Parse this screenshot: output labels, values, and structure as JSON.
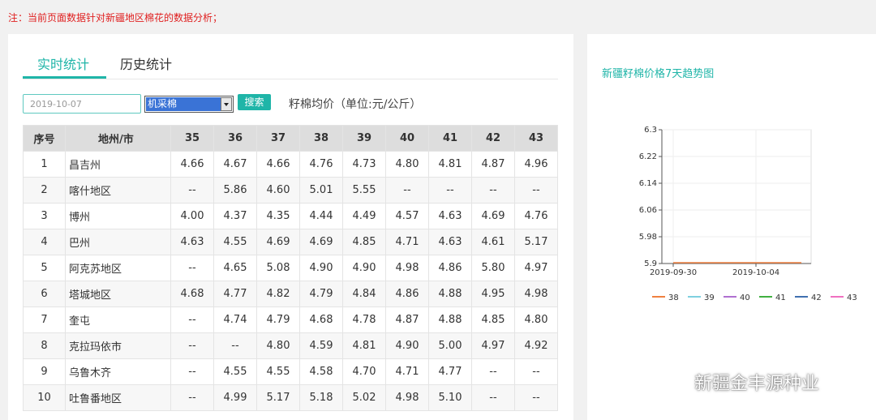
{
  "notice": "注：当前页面数据针对新疆地区棉花的数据分析；",
  "tabs": [
    {
      "label": "实时统计",
      "active": true
    },
    {
      "label": "历史统计",
      "active": false
    }
  ],
  "filters": {
    "date": "2019-10-07",
    "select_value": "机采棉",
    "search_label": "搜索",
    "unit_label": "籽棉均价（单位:元/公斤）"
  },
  "table": {
    "headers": [
      "序号",
      "地州/市",
      "35",
      "36",
      "37",
      "38",
      "39",
      "40",
      "41",
      "42",
      "43"
    ],
    "rows": [
      [
        "1",
        "昌吉州",
        "4.66",
        "4.67",
        "4.66",
        "4.76",
        "4.73",
        "4.80",
        "4.81",
        "4.87",
        "4.96"
      ],
      [
        "2",
        "喀什地区",
        "--",
        "5.86",
        "4.60",
        "5.01",
        "5.55",
        "--",
        "--",
        "--",
        "--"
      ],
      [
        "3",
        "博州",
        "4.00",
        "4.37",
        "4.35",
        "4.44",
        "4.49",
        "4.57",
        "4.63",
        "4.69",
        "4.76"
      ],
      [
        "4",
        "巴州",
        "4.63",
        "4.55",
        "4.69",
        "4.69",
        "4.85",
        "4.71",
        "4.63",
        "4.61",
        "5.17"
      ],
      [
        "5",
        "阿克苏地区",
        "--",
        "4.65",
        "5.08",
        "4.90",
        "4.90",
        "4.98",
        "4.86",
        "5.80",
        "4.97"
      ],
      [
        "6",
        "塔城地区",
        "4.68",
        "4.77",
        "4.82",
        "4.79",
        "4.84",
        "4.86",
        "4.88",
        "4.95",
        "4.98"
      ],
      [
        "7",
        "奎屯",
        "--",
        "4.74",
        "4.79",
        "4.68",
        "4.78",
        "4.87",
        "4.88",
        "4.85",
        "4.80"
      ],
      [
        "8",
        "克拉玛依市",
        "--",
        "--",
        "4.80",
        "4.59",
        "4.81",
        "4.90",
        "5.00",
        "4.97",
        "4.92"
      ],
      [
        "9",
        "乌鲁木齐",
        "--",
        "4.55",
        "4.55",
        "4.58",
        "4.70",
        "4.71",
        "4.77",
        "--",
        "--"
      ],
      [
        "10",
        "吐鲁番地区",
        "--",
        "4.99",
        "5.17",
        "5.18",
        "5.02",
        "4.98",
        "5.10",
        "--",
        "--"
      ]
    ]
  },
  "chart_data": {
    "type": "line",
    "title": "新疆籽棉价格7天趋势图",
    "x": [
      "2019-09-30",
      "2019-10-04"
    ],
    "yticks": [
      "6.3",
      "6.22",
      "6.14",
      "6.06",
      "5.98",
      "5.9"
    ],
    "ylim": [
      5.9,
      6.3
    ],
    "grid": true,
    "legend_position": "bottom",
    "series": [
      {
        "name": "38",
        "color": "#f08040"
      },
      {
        "name": "39",
        "color": "#7fd0e0"
      },
      {
        "name": "40",
        "color": "#b070d0"
      },
      {
        "name": "41",
        "color": "#40b040"
      },
      {
        "name": "42",
        "color": "#4070b0"
      },
      {
        "name": "43",
        "color": "#f070c0"
      }
    ]
  },
  "watermark": "新疆金丰源种业",
  "colors": {
    "accent": "#1fb5a8",
    "notice": "#e02020"
  }
}
